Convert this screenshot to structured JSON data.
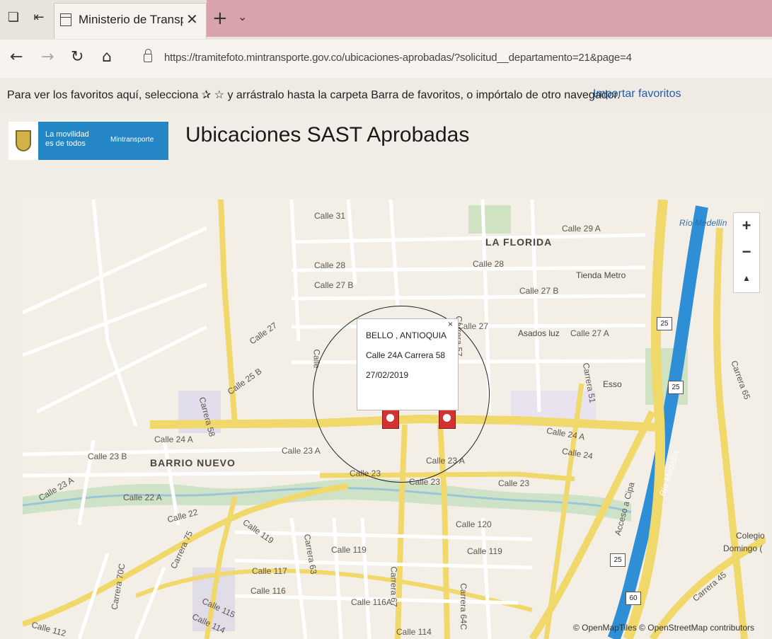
{
  "browser": {
    "tab_title": "Ministerio de Transporte",
    "tab_close": "✕",
    "new_tab": "+",
    "tab_list": "⌄",
    "back_icon": "←",
    "forward_icon": "→",
    "refresh_icon": "↻",
    "home_icon": "⌂",
    "url": "https://tramitefoto.mintransporte.gov.co/ubicaciones-aprobadas/?solicitud__departamento=21&page=4",
    "favorites_text": "Para ver los favoritos aquí, selecciona ✰ ☆ y arrástralo hasta la carpeta Barra de favoritos, o impórtalo de otro navegador.",
    "favorites_link": "Importar favoritos"
  },
  "page": {
    "logo_slogan_1": "La movilidad",
    "logo_slogan_2": "es de todos",
    "logo_ministry": "Mintransporte",
    "title": "Ubicaciones SAST Aprobadas"
  },
  "map": {
    "zoom_in": "+",
    "zoom_out": "−",
    "compass": "▲",
    "attribution": "© OpenMapTiles © OpenStreetMap contributors",
    "districts": {
      "la_florida": "LA FLORIDA",
      "barrio_nuevo": "BARRIO NUEVO"
    },
    "streets": {
      "calle_31": "Calle 31",
      "calle_29a": "Calle 29 A",
      "calle_28a": "Calle 28",
      "calle_28b": "Calle 28",
      "calle_27b_1": "Calle 27 B",
      "calle_27b_2": "Calle 27 B",
      "calle_27": "Calle 27",
      "calle_27a_1": "Calle 27",
      "calle_27a_2": "Calle 27 A",
      "calle_25b": "Calle 25 B",
      "carrera_58": "Carrera 58",
      "calle_24a_1": "Calle 24 A",
      "calle_24a_2": "Calle 24 A",
      "calle_24": "Calle 24",
      "calle_23b": "Calle 23 B",
      "calle_23a_1": "Calle 23 A",
      "calle_23a_2": "Calle 23 A",
      "calle_23a_3": "Calle 23 A",
      "calle_23_1": "Calle 23",
      "calle_23_2": "Calle 23",
      "calle_23_3": "Calle 23",
      "calle_22a": "Calle 22 A",
      "calle_22": "Calle 22",
      "calle_119_1": "Calle 119",
      "calle_119_2": "Calle 119",
      "calle_119_3": "Calle 119",
      "calle_120": "Calle 120",
      "calle_117": "Calle 117",
      "calle_116": "Calle 116",
      "calle_116a": "Calle 116A",
      "calle_115": "Calle 115",
      "calle_114_1": "Calle 114",
      "calle_114_2": "Calle 114",
      "calle_112": "Calle 112",
      "carrera_75": "Carrera 75",
      "carrera_70c": "Carrera 70C",
      "carrera_63": "Carrera 63",
      "carrera_67": "Carrera 67",
      "carrera_64c": "Carrera 64C",
      "carrera_51": "Carrera 51",
      "carrera_45": "Carrera 45",
      "carrera_57": "Carrera 57",
      "carrera_65": "Carrera 65",
      "calle": "Calle",
      "rio_medellin_1": "Río Medellín",
      "rio_medellin_2": "Río Medellín",
      "acceso_copa": "Acceso a Cipa"
    },
    "pois": {
      "tienda_metro": "Tienda Metro",
      "asados_luz": "Asados luz",
      "esso": "Esso",
      "colegio": "Colegio",
      "colegio_2": "Domingo ("
    },
    "road_shields": [
      "25",
      "25",
      "25",
      "60"
    ],
    "popup": {
      "city": "BELLO , ANTIOQUIA",
      "address": "Calle 24A Carrera 58",
      "date": "27/02/2019",
      "close": "×"
    }
  },
  "colors": {
    "brand_blue": "#2486c4",
    "road_yellow": "#f1d86b",
    "river_blue": "#2f8fd6",
    "marker_red": "#d43131"
  }
}
